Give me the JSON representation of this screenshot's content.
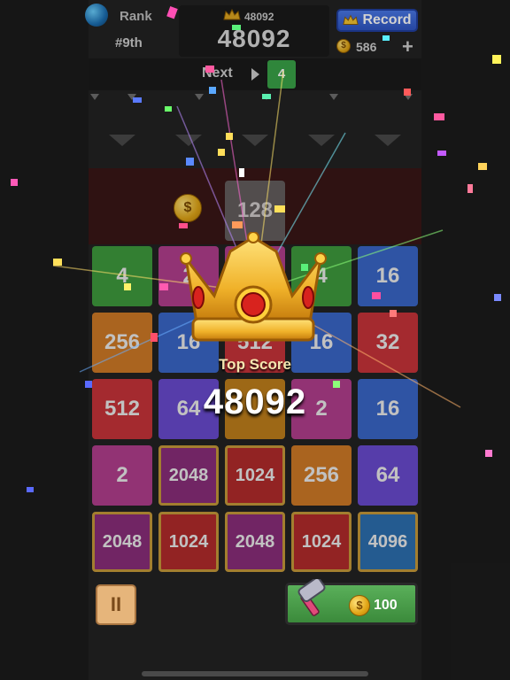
{
  "header": {
    "rank_title": "Rank",
    "rank_value": "#9th",
    "best_small": "48092",
    "score": "48092",
    "record_label": "Record",
    "coins": "586",
    "plus_label": "+"
  },
  "next": {
    "label": "Next",
    "tile_value": "4"
  },
  "preview_tile": "128",
  "board": {
    "rows": [
      [
        {
          "v": "4",
          "c": "#3f9c3d"
        },
        {
          "v": "2",
          "c": "#b23f8e"
        },
        {
          "v": "",
          "c": "#b23f8e"
        },
        {
          "v": "4",
          "c": "#3f9c3d"
        },
        {
          "v": "16",
          "c": "#3a67c8"
        }
      ],
      [
        {
          "v": "256",
          "c": "#d07a26"
        },
        {
          "v": "16",
          "c": "#3a67c8"
        },
        {
          "v": "512",
          "c": "#c8343a"
        },
        {
          "v": "16",
          "c": "#3a67c8"
        },
        {
          "v": "32",
          "c": "#c8343a"
        }
      ],
      [
        {
          "v": "512",
          "c": "#c8343a"
        },
        {
          "v": "64",
          "c": "#6a4bd0"
        },
        {
          "v": "",
          "c": "#c07f1c"
        },
        {
          "v": "2",
          "c": "#b23f8e"
        },
        {
          "v": "16",
          "c": "#3a67c8"
        }
      ],
      [
        {
          "v": "2",
          "c": "#b23f8e"
        },
        {
          "v": "2048",
          "c": "#8a2e7a",
          "f": true
        },
        {
          "v": "1024",
          "c": "#b22b2b",
          "f": true
        },
        {
          "v": "256",
          "c": "#d07a26"
        },
        {
          "v": "64",
          "c": "#6a4bd0"
        }
      ],
      [
        {
          "v": "2048",
          "c": "#8a2e7a",
          "f": true
        },
        {
          "v": "1024",
          "c": "#b22b2b",
          "f": true
        },
        {
          "v": "2048",
          "c": "#8a2e7a",
          "f": true
        },
        {
          "v": "1024",
          "c": "#b22b2b",
          "f": true
        },
        {
          "v": "4096",
          "c": "#2d6fb0",
          "f": true
        }
      ]
    ]
  },
  "popup": {
    "label": "Top Score",
    "value": "48092"
  },
  "bottom": {
    "pause_label": "II",
    "hammer_price": "100"
  },
  "icons": {
    "coin": "$",
    "rank": "globe-icon",
    "crown": "crown-icon",
    "pause": "pause-icon",
    "hammer": "hammer-icon"
  }
}
